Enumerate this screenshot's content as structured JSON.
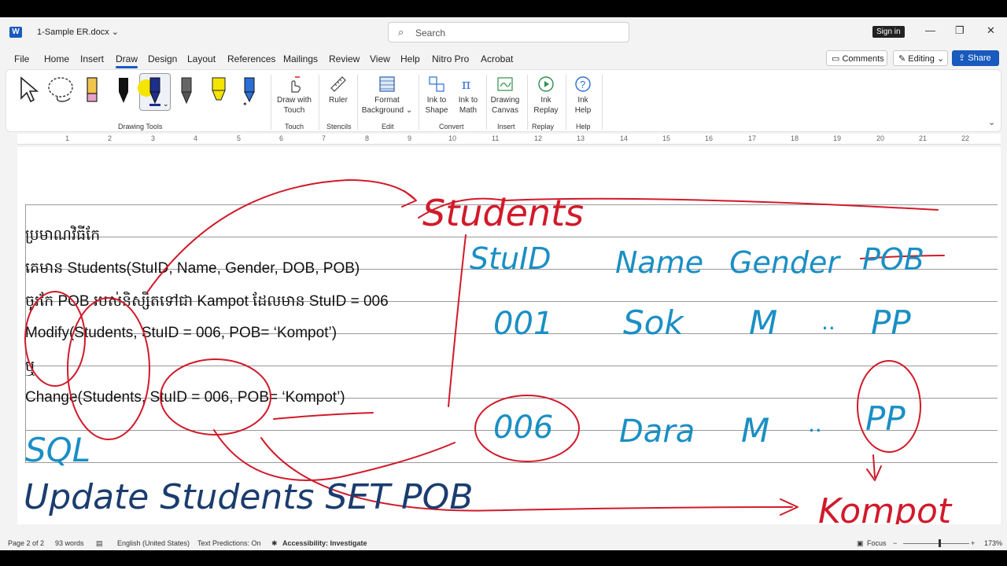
{
  "titlebar": {
    "app_logo": "W",
    "doc_title": "1-Sample ER.docx",
    "search_placeholder": "Search",
    "signin": "Sign in"
  },
  "menu": {
    "tabs": [
      "File",
      "Home",
      "Insert",
      "Draw",
      "Design",
      "Layout",
      "References",
      "Mailings",
      "Review",
      "View",
      "Help",
      "Nitro Pro",
      "Acrobat"
    ],
    "active_tab": "Draw",
    "comments": "Comments",
    "editing": "Editing",
    "share": "Share"
  },
  "ribbon": {
    "drawing_tools_label": "Drawing Tools",
    "buttons": {
      "draw_with_touch": "Draw with Touch",
      "ruler": "Ruler",
      "format_background": "Format Background",
      "ink_to_shape": "Ink to Shape",
      "ink_to_math": "Ink to Math",
      "drawing_canvas": "Drawing Canvas",
      "ink_replay": "Ink Replay",
      "ink_help": "Ink Help"
    },
    "groups": {
      "touch": "Touch",
      "stencils": "Stencils",
      "edit": "Edit",
      "convert": "Convert",
      "insert": "Insert",
      "replay": "Replay",
      "help": "Help"
    }
  },
  "ruler": {
    "numbers": [
      "1",
      "2",
      "3",
      "4",
      "5",
      "6",
      "7",
      "8",
      "9",
      "10",
      "11",
      "12",
      "13",
      "14",
      "15",
      "16",
      "17",
      "18",
      "19",
      "20",
      "21",
      "22"
    ]
  },
  "document": {
    "lines": [
      "ប្រមាណវិធីកែ",
      "គេមាន Students(StuID, Name, Gender, DOB, POB)",
      "ចូរកែ POB របស់និស្សិតទៅជា Kampot ដែលមាន StuID = 006",
      "Modify(Students, StuID = 006, POB= ‘Kompot’)",
      "ឬ",
      "Change(Students, StuID = 006, POB= ‘Kompot’)"
    ],
    "handwriting": {
      "students": "Students",
      "stuid": "StuID",
      "name": "Name",
      "gender": "Gender",
      "pob": "POB",
      "r1_id": "001",
      "r1_name": "Sok",
      "r1_gender": "M",
      "r1_dots": "..",
      "r1_pob": "PP",
      "r2_id": "006",
      "r2_name": "Dara",
      "r2_gender": "M",
      "r2_dots": "..",
      "r2_pob": "PP",
      "sql": "SQL",
      "update": "Update Students SET POB",
      "kompot": "Kompot"
    }
  },
  "statusbar": {
    "page": "Page 2 of 2",
    "words": "93 words",
    "language": "English (United States)",
    "predictions": "Text Predictions: On",
    "accessibility": "Accessibility: Investigate",
    "focus": "Focus",
    "zoom": "173%"
  },
  "colors": {
    "accent": "#185abd",
    "ink_red": "#d11a2a",
    "ink_blue": "#1a8fc4",
    "ink_navy": "#1b3c6e"
  }
}
